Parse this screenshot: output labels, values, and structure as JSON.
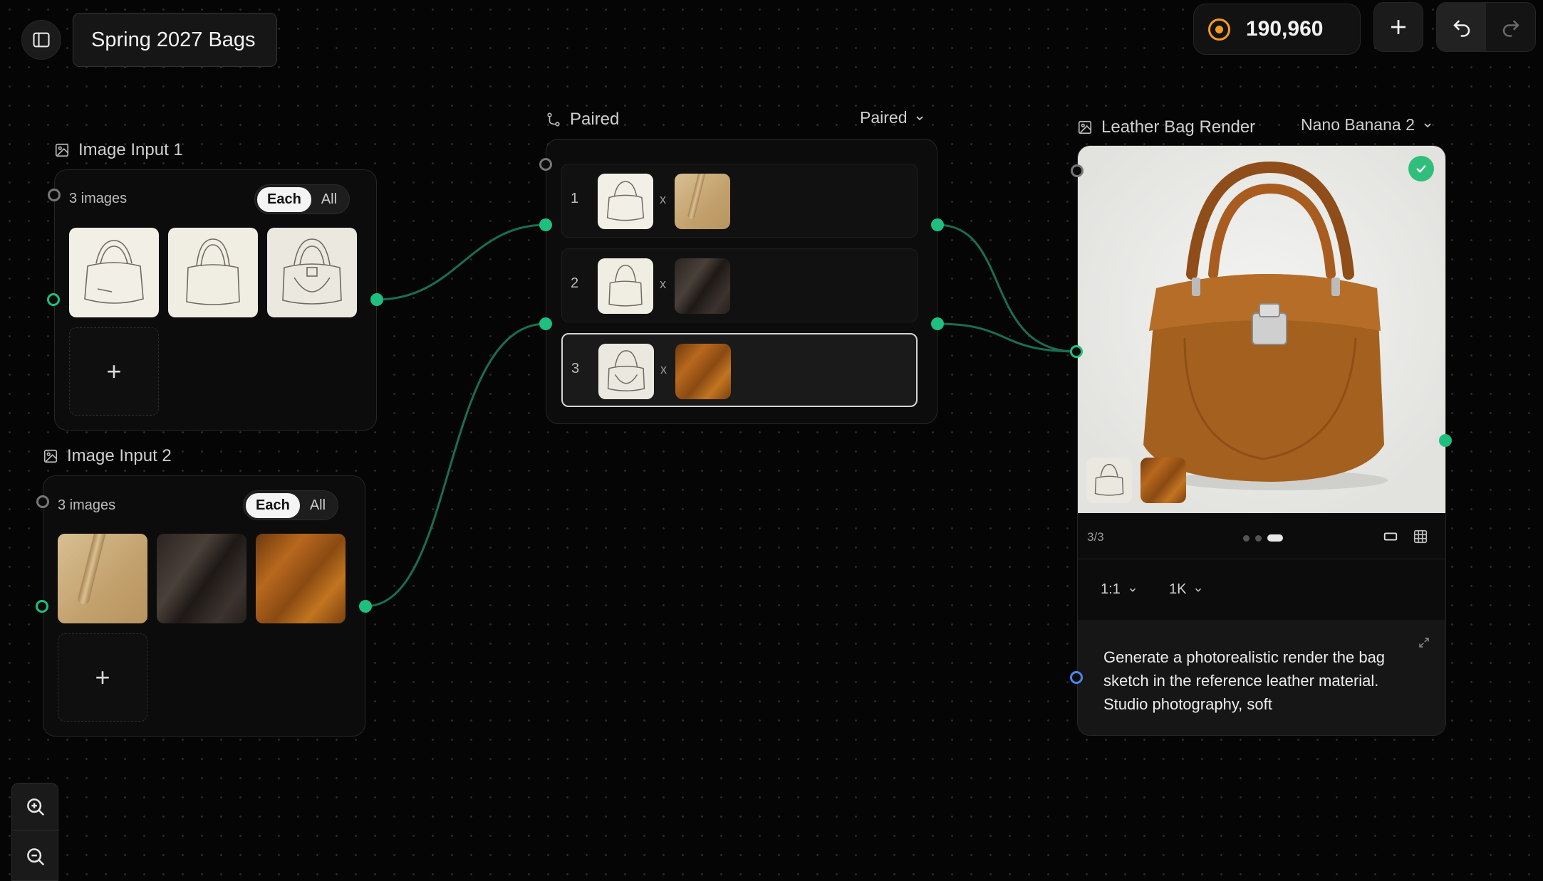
{
  "header": {
    "project_title": "Spring 2027 Bags",
    "credits": "190,960"
  },
  "image_input_1": {
    "title": "Image Input 1",
    "count": "3 images",
    "toggle_each": "Each",
    "toggle_all": "All",
    "add": "+"
  },
  "image_input_2": {
    "title": "Image Input 2",
    "count": "3 images",
    "toggle_each": "Each",
    "toggle_all": "All",
    "add": "+"
  },
  "paired": {
    "title": "Paired",
    "mode": "Paired",
    "rows": [
      {
        "index": "1",
        "sep": "x"
      },
      {
        "index": "2",
        "sep": "x"
      },
      {
        "index": "3",
        "sep": "x"
      }
    ]
  },
  "render": {
    "title": "Leather Bag Render",
    "model": "Nano Banana 2",
    "counter": "3/3",
    "aspect": "1:1",
    "resolution": "1K",
    "prompt": "Generate a photorealistic render the bag sketch in the reference leather material. Studio photography, soft"
  },
  "colors": {
    "accent_green": "#1fbf7f",
    "credits_orange": "#f59a23",
    "port_blue": "#4a86f0"
  }
}
